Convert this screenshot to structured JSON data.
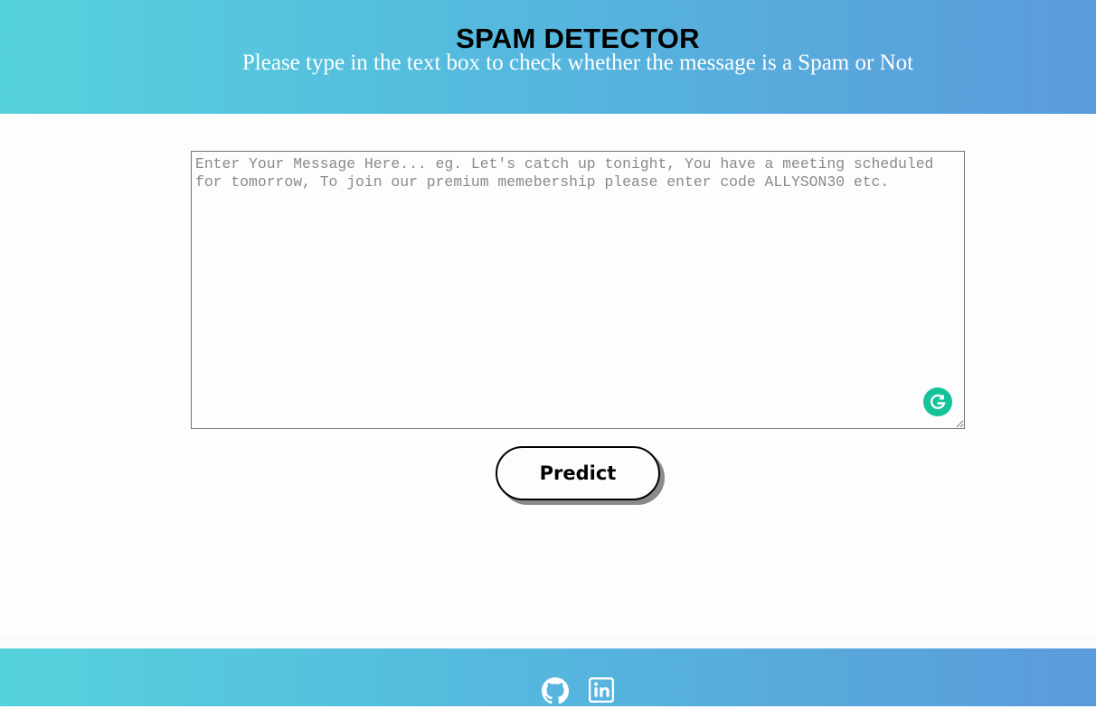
{
  "header": {
    "title": "SPAM DETECTOR",
    "subtitle": "Please type in the text box to check whether the message is a Spam or Not",
    "gradient_start": "#56d2dc",
    "gradient_end": "#5a9bdb"
  },
  "form": {
    "message_placeholder": "Enter Your Message Here... eg. Let's catch up tonight, You have a meeting scheduled for tomorrow, To join our premium memebership please enter code ALLYSON30 etc.",
    "message_value": "",
    "predict_label": "Predict",
    "grammarly_icon": "grammarly-icon",
    "grammarly_color": "#15c39a"
  },
  "footer": {
    "links": [
      {
        "icon": "github-icon",
        "label": "GitHub"
      },
      {
        "icon": "linkedin-icon",
        "label": "LinkedIn"
      }
    ]
  }
}
